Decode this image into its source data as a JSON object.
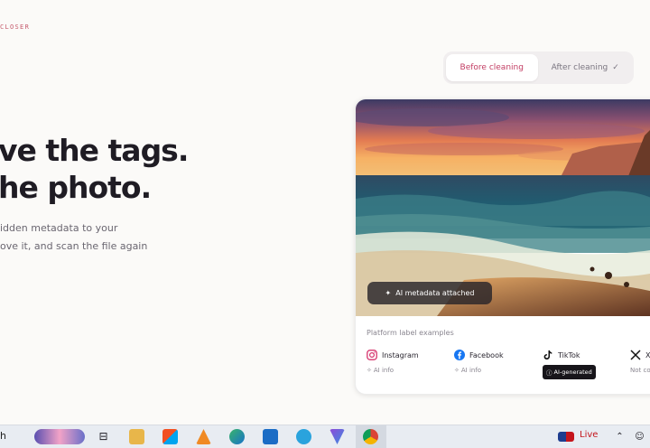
{
  "eyebrow": "CLOSER",
  "headline": {
    "line1": "ve the tags.",
    "line2": "he photo."
  },
  "subtext": {
    "line1": "idden metadata to your",
    "line2": "ove it, and scan the file again"
  },
  "toggle": {
    "before_label": "Before cleaning",
    "after_label": "After cleaning",
    "selected": "Before cleaning"
  },
  "card": {
    "pill_label": "AI metadata attached",
    "platform_title": "Platform label examples",
    "platforms": [
      {
        "name": "Instagram",
        "label": "AI info",
        "icon": "instagram-icon"
      },
      {
        "name": "Facebook",
        "label": "AI info",
        "icon": "facebook-icon"
      },
      {
        "name": "TikTok",
        "label": "AI-generated",
        "icon": "tiktok-icon"
      },
      {
        "name": "X",
        "label": "Not co",
        "icon": "x-icon"
      }
    ]
  },
  "taskbar": {
    "search_fragment": "h",
    "live_label": "Live"
  },
  "colors": {
    "accent": "#c23d63",
    "eyebrow": "#c55a6c",
    "background": "#fbfaf8"
  }
}
